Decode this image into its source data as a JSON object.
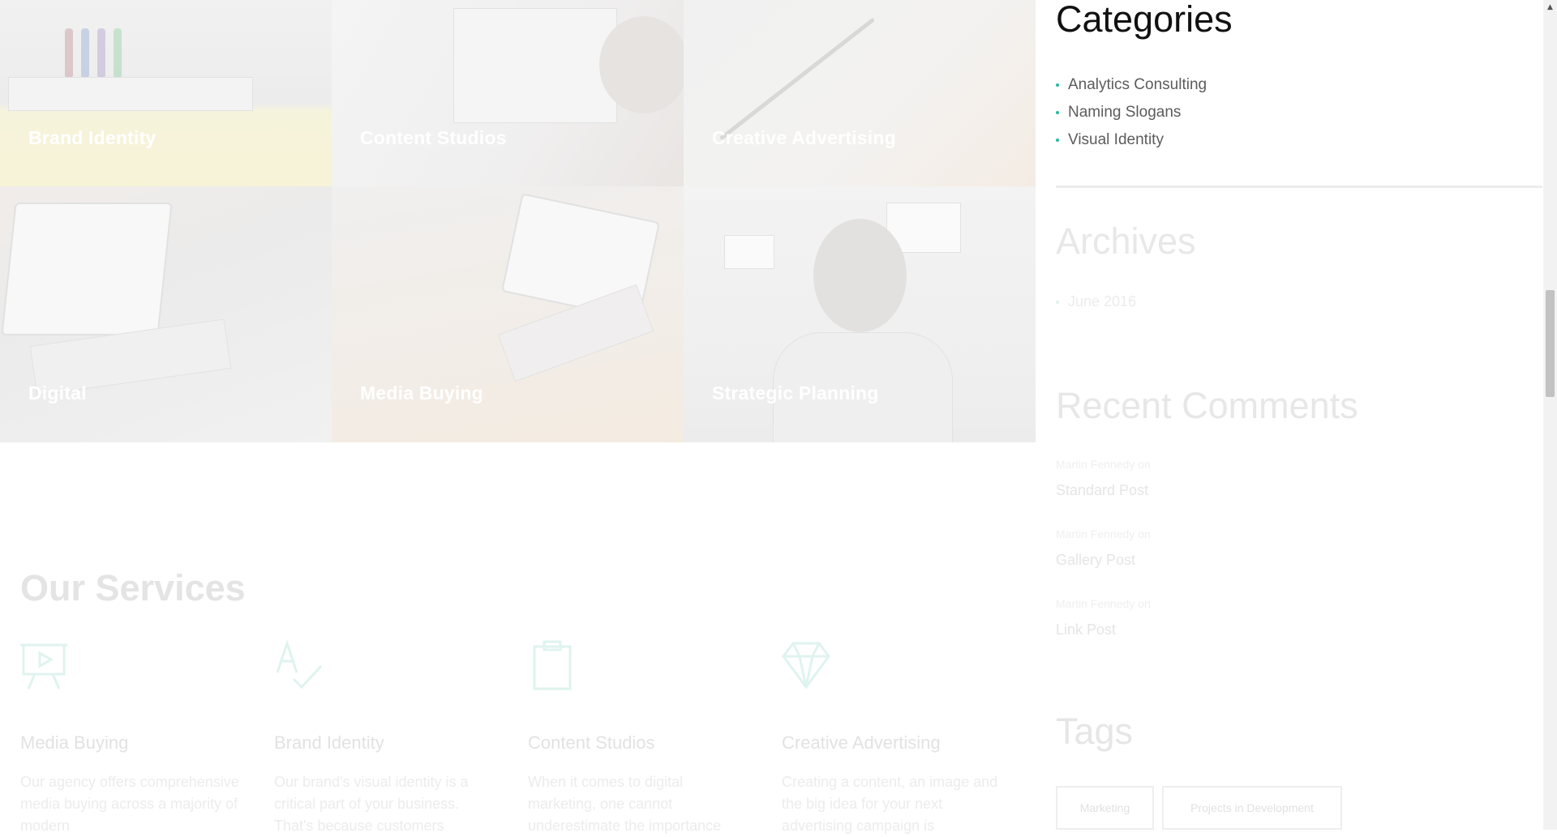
{
  "portfolio": {
    "tiles": [
      {
        "label": "Brand Identity"
      },
      {
        "label": "Content Studios"
      },
      {
        "label": "Creative Advertising"
      },
      {
        "label": "Digital"
      },
      {
        "label": "Media Buying"
      },
      {
        "label": "Strategic Planning"
      }
    ]
  },
  "services": {
    "title": "Our Services",
    "items": [
      {
        "name": "Media Buying",
        "icon": "presentation-board-icon",
        "desc": "Our agency offers comprehensive media buying across a majority of modern"
      },
      {
        "name": "Brand Identity",
        "icon": "spellcheck-icon",
        "desc": "Our brand's visual identity is a critical part of your business. That's because customers"
      },
      {
        "name": "Content Studios",
        "icon": "clipboard-icon",
        "desc": "When it comes to digital marketing, one cannot underestimate the importance"
      },
      {
        "name": "Creative Advertising",
        "icon": "diamond-icon",
        "desc": "Creating a content, an image and the big idea for your next advertising campaign is"
      }
    ]
  },
  "sidebar": {
    "categories": {
      "title": "Categories",
      "items": [
        "Analytics Consulting",
        "Naming Slogans",
        "Visual Identity"
      ]
    },
    "archives": {
      "title": "Archives",
      "items": [
        "June 2016"
      ]
    },
    "recent_comments": {
      "title": "Recent Comments",
      "items": [
        {
          "author": "Martin Fennedy",
          "on": "on",
          "post": "Standard Post"
        },
        {
          "author": "Martin Fennedy",
          "on": "on",
          "post": "Gallery Post"
        },
        {
          "author": "Martin Fennedy",
          "on": "on",
          "post": "Link Post"
        }
      ]
    },
    "tags": {
      "title": "Tags",
      "items": [
        "Marketing",
        "Projects in Development"
      ]
    }
  },
  "colors": {
    "accent": "#29b9a3",
    "heading": "#111111",
    "body_text": "#5c5c5c"
  }
}
